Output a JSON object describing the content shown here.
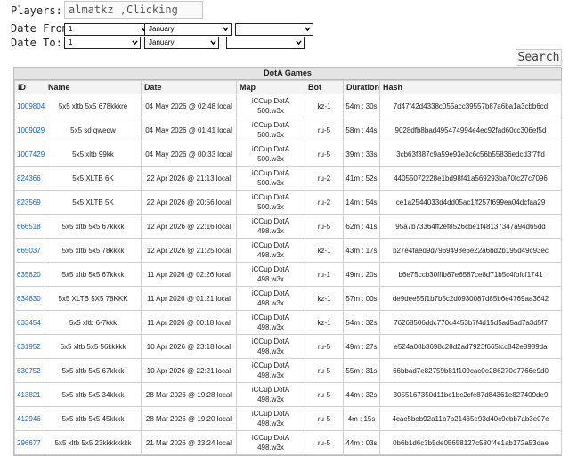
{
  "filters": {
    "players_label": "Players:",
    "players_value": "almatkz ,Clicking",
    "date_from_label": "Date From:",
    "date_to_label": "Date To:",
    "date_from": {
      "day": "1",
      "month": "January",
      "year": ""
    },
    "date_to": {
      "day": "1",
      "month": "January",
      "year": ""
    },
    "search_label": "Search"
  },
  "games": {
    "title": "DotA Games",
    "columns": [
      "ID",
      "Name",
      "Date",
      "Map",
      "Bot",
      "Duration",
      "Hash"
    ],
    "rows": [
      {
        "id": "1009804",
        "name": "5x5 xltb 5x5 678kkkre",
        "date": "04 May 2026 @ 02:48 local",
        "map": "iCCup DotA 500.w3x",
        "bot": "kz-1",
        "duration": "54m : 30s",
        "hash": "7d47f42d4338c055acc39557b87a6ba1a3cbb6cd"
      },
      {
        "id": "1009029",
        "name": "5x5 sd qweqw",
        "date": "04 May 2026 @ 01:41 local",
        "map": "iCCup DotA 500.w3x",
        "bot": "ru-5",
        "duration": "58m : 44s",
        "hash": "9028dfb8bad495474994e4ec92fad60cc306ef5d"
      },
      {
        "id": "1007429",
        "name": "5x5 xltb 99kk",
        "date": "04 May 2026 @ 00:33 local",
        "map": "iCCup DotA 500.w3x",
        "bot": "ru-5",
        "duration": "39m : 33s",
        "hash": "3cb63f387c9a59e93e3c6c56b55836edcd3f7ffd"
      },
      {
        "id": "824366",
        "name": "5x5 XLTB 6K",
        "date": "22 Apr 2026 @ 21:13 local",
        "map": "iCCup DotA 500.w3x",
        "bot": "ru-2",
        "duration": "41m : 52s",
        "hash": "44055072228e1bd98f41a569293ba70fc27c7096"
      },
      {
        "id": "823569",
        "name": "5x5 XLTB 5K",
        "date": "22 Apr 2026 @ 20:56 local",
        "map": "iCCup DotA 500.w3x",
        "bot": "ru-2",
        "duration": "14m : 54s",
        "hash": "ce1a2544033d4dd05ac1ff257f699ea04dcfaa29"
      },
      {
        "id": "666518",
        "name": "5x5 xltb 5x5 67kkkk",
        "date": "12 Apr 2026 @ 22:16 local",
        "map": "iCCup DotA 498.w3x",
        "bot": "ru-5",
        "duration": "62m : 41s",
        "hash": "95a7b73364ff2ef8526cbe1f48137347a94d65dd"
      },
      {
        "id": "665037",
        "name": "5x5 xltb 5x5 78kkkk",
        "date": "12 Apr 2026 @ 21:25 local",
        "map": "iCCup DotA 498.w3x",
        "bot": "kz-1",
        "duration": "43m : 17s",
        "hash": "b27e4faed9d7969498e6e22a6bd2b195d49c93ec"
      },
      {
        "id": "635820",
        "name": "5x5 xltb 5x5 67kkkk",
        "date": "11 Apr 2026 @ 02:26 local",
        "map": "iCCup DotA 498.w3x",
        "bot": "ru-1",
        "duration": "49m : 20s",
        "hash": "b6e75ccb30fffb87e6587ce8d71b5c4fbfcf1741"
      },
      {
        "id": "634830",
        "name": "5x5 XLTB 5X5 78KKK",
        "date": "11 Apr 2026 @ 01:21 local",
        "map": "iCCup DotA 498.w3x",
        "bot": "kz-1",
        "duration": "57m : 00s",
        "hash": "de9dee55f1b7b5c2d0930087d85b6e4769aa3642"
      },
      {
        "id": "633454",
        "name": "5x5 xltb 6-7kkk",
        "date": "11 Apr 2026 @ 00:18 local",
        "map": "iCCup DotA 498.w3x",
        "bot": "kz-1",
        "duration": "54m : 32s",
        "hash": "76268506ddc770c4453b7f4d15d5ad5ad7a3d5f7"
      },
      {
        "id": "631952",
        "name": "5x5 xltb 5x5 56kkkkk",
        "date": "10 Apr 2026 @ 23:18 local",
        "map": "iCCup DotA 498.w3x",
        "bot": "ru-5",
        "duration": "49m : 27s",
        "hash": "e524a08b3698c28d2ad7923f665fcc842e8989da"
      },
      {
        "id": "630752",
        "name": "5x5 xltb 5x5 67kkkk",
        "date": "10 Apr 2026 @ 22:21 local",
        "map": "iCCup DotA 498.w3x",
        "bot": "ru-5",
        "duration": "55m : 31s",
        "hash": "66bbad7e82759b81f109cac0e286270e7766e9d0"
      },
      {
        "id": "413821",
        "name": "5x5 xltb 5x5 34kkkk",
        "date": "28 Mar 2026 @ 19:28 local",
        "map": "iCCup DotA 498.w3x",
        "bot": "ru-5",
        "duration": "44m : 32s",
        "hash": "3055167350d11bc1bc2cfe87d84361e827409de9"
      },
      {
        "id": "412946",
        "name": "5x5 xltb 5x5 45kkkk",
        "date": "28 Mar 2026 @ 19:20 local",
        "map": "iCCup DotA 498.w3x",
        "bot": "ru-5",
        "duration": "4m : 15s",
        "hash": "4cac5beb92a11b7b21465e93d40c9ebb7ab3e07e"
      },
      {
        "id": "296677",
        "name": "5x5 xltb 5x5 23kkkkkkkk",
        "date": "21 Mar 2026 @ 23:24 local",
        "map": "iCCup DotA 498.w3x",
        "bot": "ru-5",
        "duration": "44m : 03s",
        "hash": "0b6b1d6c3b5de05658127c580f4e1ab172a53dae"
      }
    ]
  }
}
